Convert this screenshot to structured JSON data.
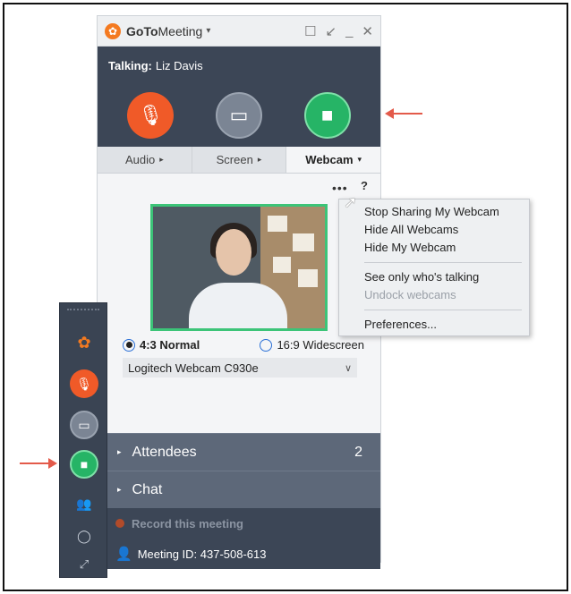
{
  "window": {
    "brand_prefix": "GoTo",
    "brand_suffix": "Meeting",
    "talking_label": "Talking:",
    "talking_name": "Liz Davis"
  },
  "tabs": [
    {
      "label": "Audio",
      "active": false
    },
    {
      "label": "Screen",
      "active": false
    },
    {
      "label": "Webcam",
      "active": true
    }
  ],
  "webcam": {
    "more_label": "•••",
    "help_label": "?",
    "ratio_normal": "4:3 Normal",
    "ratio_wide": "16:9 Widescreen",
    "selected_ratio": "4:3 Normal",
    "device": "Logitech Webcam C930e"
  },
  "context_menu": {
    "items": [
      {
        "label": "Stop Sharing My Webcam",
        "enabled": true
      },
      {
        "label": "Hide All Webcams",
        "enabled": true
      },
      {
        "label": "Hide My Webcam",
        "enabled": true
      },
      {
        "label": "See only who's talking",
        "enabled": true
      },
      {
        "label": "Undock webcams",
        "enabled": false
      },
      {
        "label": "Preferences...",
        "enabled": true
      }
    ]
  },
  "sections": {
    "attendees_label": "Attendees",
    "attendees_count": "2",
    "chat_label": "Chat"
  },
  "footer": {
    "record_label": "Record this meeting",
    "meeting_id": "Meeting ID: 437-508-613"
  },
  "colors": {
    "accent_orange": "#f05a28",
    "accent_green": "#26b466",
    "panel_dark": "#3c4656",
    "arrow_red": "#e35a4a"
  },
  "icons": {
    "mic": "mic-off-icon",
    "screen": "monitor-icon",
    "camera": "video-camera-icon",
    "attendees": "people-icon",
    "chat": "chat-bubble-icon",
    "expand": "expand-icon"
  }
}
